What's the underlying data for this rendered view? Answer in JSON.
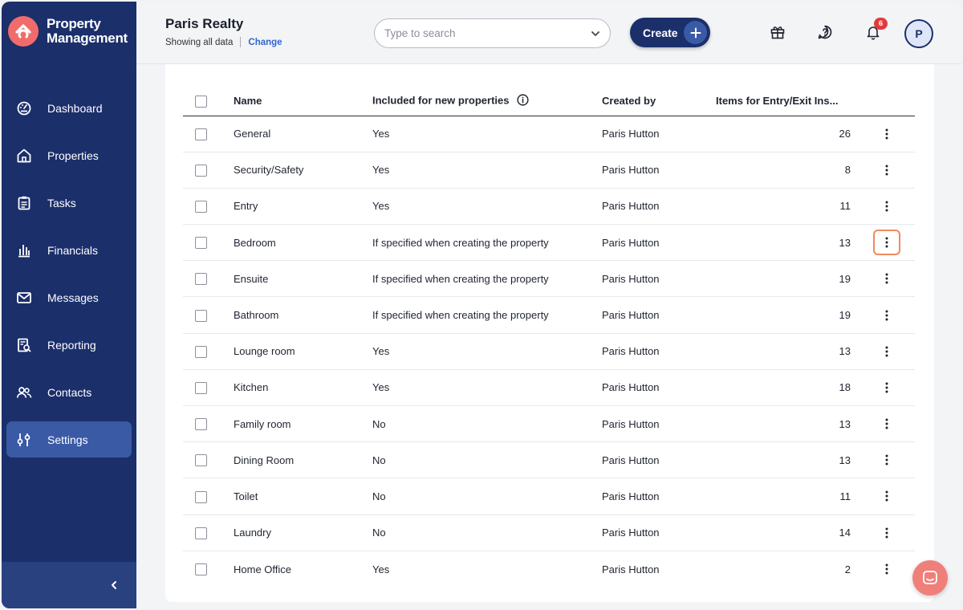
{
  "app": {
    "brand_line1": "Property",
    "brand_line2": "Management",
    "brand_color": "#1b2f6b",
    "accent_color": "#f26b6b"
  },
  "sidebar": {
    "items": [
      {
        "label": "Dashboard",
        "icon": "dashboard-icon"
      },
      {
        "label": "Properties",
        "icon": "home-icon"
      },
      {
        "label": "Tasks",
        "icon": "clipboard-icon"
      },
      {
        "label": "Financials",
        "icon": "bank-icon"
      },
      {
        "label": "Messages",
        "icon": "mail-icon"
      },
      {
        "label": "Reporting",
        "icon": "report-icon"
      },
      {
        "label": "Contacts",
        "icon": "people-icon"
      },
      {
        "label": "Settings",
        "icon": "sliders-icon",
        "active": true
      }
    ],
    "collapse_icon": "chevron-left-icon"
  },
  "header": {
    "title": "Paris Realty",
    "subtitle": "Showing all data",
    "change_link": "Change",
    "search_placeholder": "Type to search",
    "create_label": "Create",
    "notification_count": "6",
    "avatar_initial": "P"
  },
  "table": {
    "columns": {
      "name": "Name",
      "included": "Included for new properties",
      "created_by": "Created by",
      "items": "Items for Entry/Exit Ins..."
    },
    "rows": [
      {
        "name": "General",
        "included": "Yes",
        "created_by": "Paris Hutton",
        "items": "26"
      },
      {
        "name": "Security/Safety",
        "included": "Yes",
        "created_by": "Paris Hutton",
        "items": "8"
      },
      {
        "name": "Entry",
        "included": "Yes",
        "created_by": "Paris Hutton",
        "items": "11"
      },
      {
        "name": "Bedroom",
        "included": "If specified when creating the property",
        "created_by": "Paris Hutton",
        "items": "13",
        "focused": true
      },
      {
        "name": "Ensuite",
        "included": "If specified when creating the property",
        "created_by": "Paris Hutton",
        "items": "19"
      },
      {
        "name": "Bathroom",
        "included": "If specified when creating the property",
        "created_by": "Paris Hutton",
        "items": "19"
      },
      {
        "name": "Lounge room",
        "included": "Yes",
        "created_by": "Paris Hutton",
        "items": "13"
      },
      {
        "name": "Kitchen",
        "included": "Yes",
        "created_by": "Paris Hutton",
        "items": "18"
      },
      {
        "name": "Family room",
        "included": "No",
        "created_by": "Paris Hutton",
        "items": "13"
      },
      {
        "name": "Dining Room",
        "included": "No",
        "created_by": "Paris Hutton",
        "items": "13"
      },
      {
        "name": "Toilet",
        "included": "No",
        "created_by": "Paris Hutton",
        "items": "11"
      },
      {
        "name": "Laundry",
        "included": "No",
        "created_by": "Paris Hutton",
        "items": "14"
      },
      {
        "name": "Home Office",
        "included": "Yes",
        "created_by": "Paris Hutton",
        "items": "2"
      }
    ]
  }
}
